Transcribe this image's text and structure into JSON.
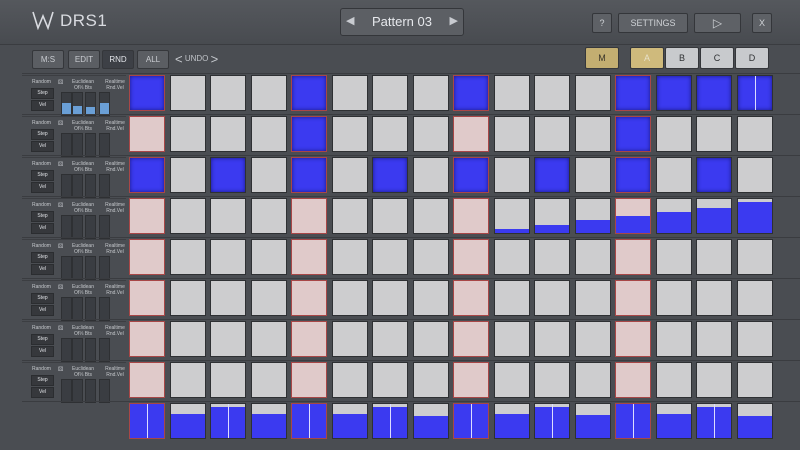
{
  "app": {
    "brand": "DRS1",
    "logo_icon": "w-logo-icon"
  },
  "pattern": {
    "name": "Pattern 03",
    "prev_icon": "triangle-left-icon",
    "next_icon": "triangle-right-icon"
  },
  "header_buttons": {
    "help": "?",
    "settings": "SETTINGS",
    "play": "▷",
    "close": "X"
  },
  "toolbar": {
    "ms": "M:S",
    "edit": "EDIT",
    "rnd": "RND",
    "all": "ALL",
    "undo": "UNDO",
    "undo_left": "<",
    "undo_right": ">",
    "m": "M",
    "a": "A",
    "b": "B",
    "c": "C",
    "d": "D"
  },
  "colors": {
    "on": "#3b3af0",
    "off": "#cdcdcf",
    "accent_cell": "#e0caca",
    "accent_border": "#a84747",
    "gold": "#c3ae71"
  },
  "rows": [
    {
      "random": "Random",
      "step": "Step",
      "vel": "Vel",
      "euclid": "Euclidean",
      "of_bts": "Of⅓ Bts",
      "realtime": "Realtime",
      "rnd_vel": "Rnd.Vel",
      "meters": [
        0.55,
        0.4,
        0.35,
        0.55
      ]
    },
    {
      "random": "Random",
      "step": "Step",
      "vel": "Vel",
      "euclid": "Euclidean",
      "of_bts": "Of⅓ Bts",
      "realtime": "Realtime",
      "rnd_vel": "Rnd.Vel",
      "meters": [
        0,
        0,
        0,
        0
      ]
    },
    {
      "random": "Random",
      "step": "Step",
      "vel": "Vel",
      "euclid": "Euclidean",
      "of_bts": "Of⅓ Bts",
      "realtime": "Realtime",
      "rnd_vel": "Rnd.Vel",
      "meters": [
        0,
        0,
        0,
        0
      ]
    },
    {
      "random": "Random",
      "step": "Step",
      "vel": "Vel",
      "euclid": "Euclidean",
      "of_bts": "Of⅓ Bts",
      "realtime": "Realtime",
      "rnd_vel": "Rnd.Vel",
      "meters": [
        0,
        0,
        0,
        0
      ]
    },
    {
      "random": "Random",
      "step": "Step",
      "vel": "Vel",
      "euclid": "Euclidean",
      "of_bts": "Of⅓ Bts",
      "realtime": "Realtime",
      "rnd_vel": "Rnd.Vel",
      "meters": [
        0,
        0,
        0,
        0
      ]
    },
    {
      "random": "Random",
      "step": "Step",
      "vel": "Vel",
      "euclid": "Euclidean",
      "of_bts": "Of⅓ Bts",
      "realtime": "Realtime",
      "rnd_vel": "Rnd.Vel",
      "meters": [
        0,
        0,
        0,
        0
      ]
    },
    {
      "random": "Random",
      "step": "Step",
      "vel": "Vel",
      "euclid": "Euclidean",
      "of_bts": "Of⅓ Bts",
      "realtime": "Realtime",
      "rnd_vel": "Rnd.Vel",
      "meters": [
        0,
        0,
        0,
        0
      ]
    },
    {
      "random": "Random",
      "step": "Step",
      "vel": "Vel",
      "euclid": "Euclidean",
      "of_bts": "Of⅓ Bts",
      "realtime": "Realtime",
      "rnd_vel": "Rnd.Vel",
      "meters": [
        0,
        0,
        0,
        0
      ]
    }
  ],
  "grid": {
    "accent_columns": [
      0,
      4,
      8,
      12
    ],
    "steps": [
      [
        1,
        0,
        0,
        0,
        1,
        0,
        0,
        0,
        1,
        0,
        0,
        0,
        1,
        1,
        1,
        1
      ],
      [
        0,
        0,
        0,
        0,
        1,
        0,
        0,
        0,
        0,
        0,
        0,
        0,
        1,
        0,
        0,
        0
      ],
      [
        1,
        0,
        1,
        0,
        1,
        0,
        1,
        0,
        1,
        0,
        1,
        0,
        1,
        0,
        1,
        0
      ],
      [
        0,
        0,
        0,
        0,
        0,
        0,
        0,
        0,
        0,
        0,
        0,
        0,
        0,
        0,
        0,
        0
      ],
      [
        0,
        0,
        0,
        0,
        0,
        0,
        0,
        0,
        0,
        0,
        0,
        0,
        0,
        0,
        0,
        0
      ],
      [
        0,
        0,
        0,
        0,
        0,
        0,
        0,
        0,
        0,
        0,
        0,
        0,
        0,
        0,
        0,
        0
      ],
      [
        0,
        0,
        0,
        0,
        0,
        0,
        0,
        0,
        0,
        0,
        0,
        0,
        0,
        0,
        0,
        0
      ],
      [
        0,
        0,
        0,
        0,
        0,
        0,
        0,
        0,
        0,
        0,
        0,
        0,
        0,
        0,
        0,
        0
      ]
    ],
    "ramp_row": 3,
    "ramp_levels": [
      0,
      0,
      0,
      0,
      0,
      0,
      0,
      0,
      0,
      0.12,
      0.25,
      0.38,
      0.5,
      0.62,
      0.75,
      0.9
    ],
    "velocities": [
      1.0,
      0.72,
      0.92,
      0.7,
      1.0,
      0.7,
      0.9,
      0.65,
      1.0,
      0.7,
      0.92,
      0.68,
      1.0,
      0.7,
      0.9,
      0.65
    ],
    "velocity_split": [
      true,
      false,
      true,
      false,
      true,
      false,
      true,
      false,
      true,
      false,
      true,
      false,
      true,
      false,
      true,
      false
    ]
  }
}
